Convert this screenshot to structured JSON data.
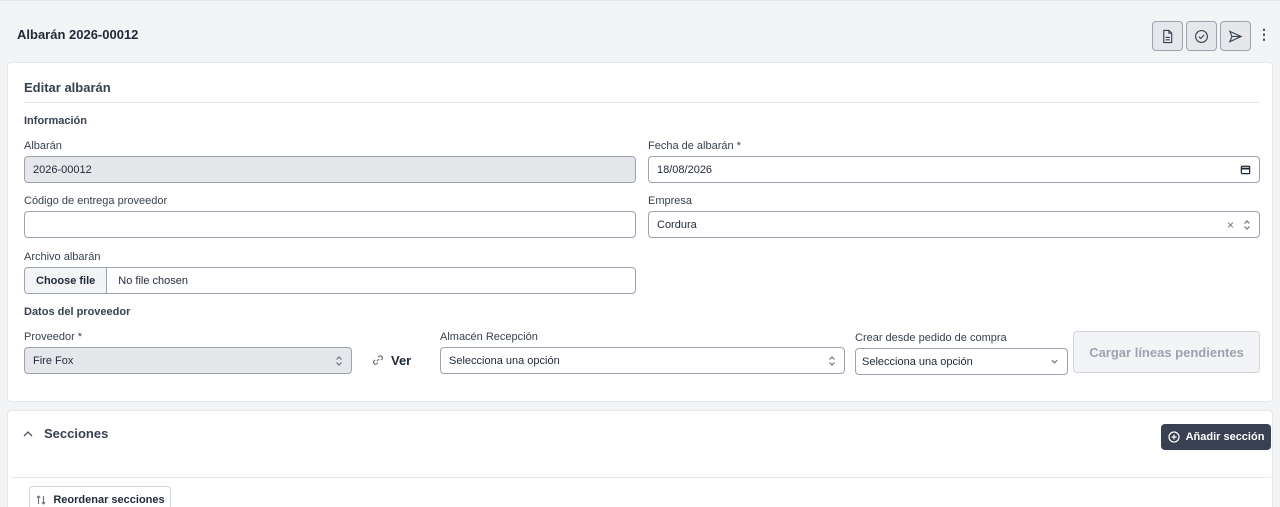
{
  "header": {
    "title": "Albarán 2026-00012",
    "actions": [
      {
        "icon": "document-icon"
      },
      {
        "icon": "check-circle-icon"
      },
      {
        "icon": "send-icon"
      }
    ],
    "more_icon": "⋮"
  },
  "form": {
    "title": "Editar albarán",
    "info_section": "Información",
    "albaran": {
      "label": "Albarán",
      "value": "2026-00012"
    },
    "fecha": {
      "label": "Fecha de albarán *",
      "value": "18/08/2026"
    },
    "codigo": {
      "label": "Código de entrega proveedor",
      "value": ""
    },
    "empresa": {
      "label": "Empresa",
      "value": "Cordura",
      "clear": "×",
      "toggle": "⌃⌄"
    },
    "archivo": {
      "label": "Archivo albarán",
      "button": "Choose file",
      "status": "No file chosen"
    },
    "supplier_section": "Datos del proveedor",
    "proveedor": {
      "label": "Proveedor *",
      "value": "Fire Fox"
    },
    "ver_label": "Ver",
    "almacen": {
      "label": "Almacén Recepción",
      "placeholder": "Selecciona una opción"
    },
    "pedido": {
      "label": "Crear desde pedido de compra",
      "placeholder": "Selecciona una opción"
    },
    "load_button": "Cargar líneas pendientes"
  },
  "sections": {
    "title": "Secciones",
    "add_button": "Añadir sección",
    "reorder_button": "Reordenar secciones"
  },
  "colors": {
    "accent": "#374151",
    "disabled_bg": "#e5e7eb"
  }
}
